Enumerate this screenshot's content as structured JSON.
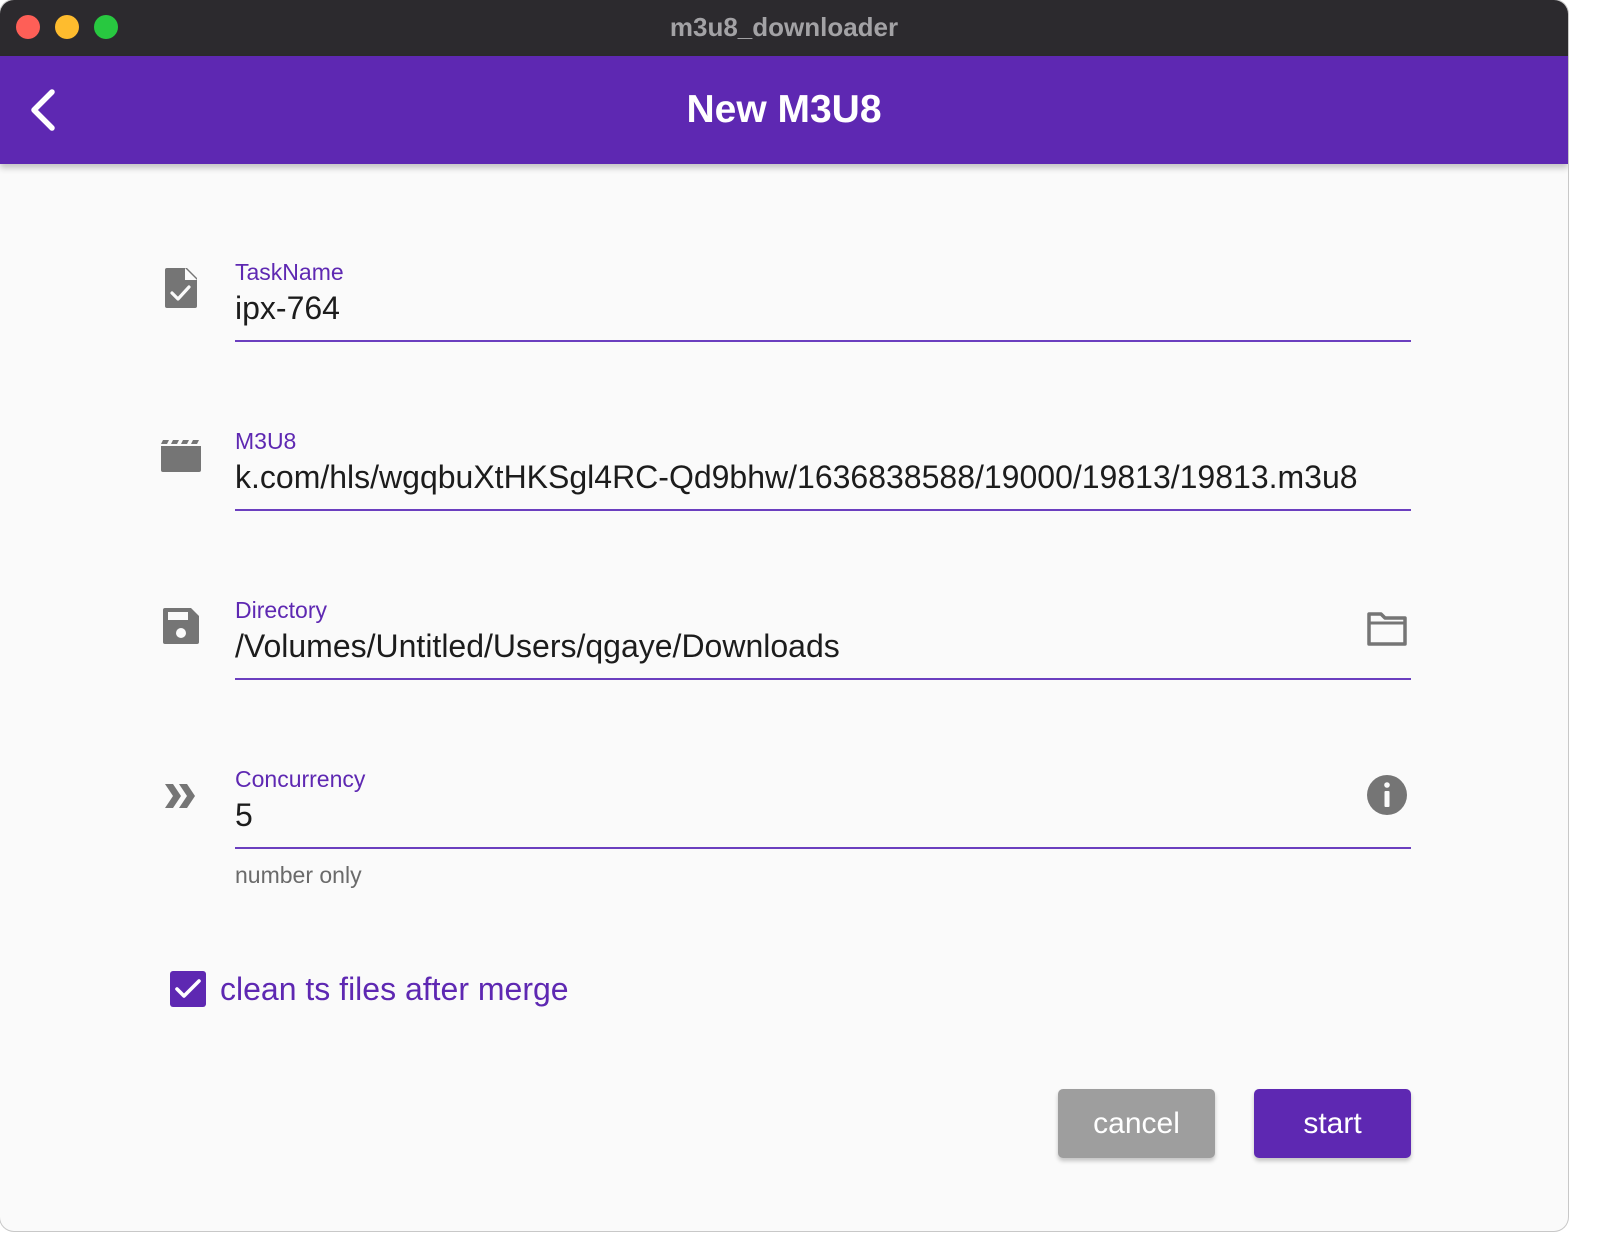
{
  "window": {
    "title": "m3u8_downloader"
  },
  "appbar": {
    "title": "New M3U8"
  },
  "form": {
    "task_name": {
      "label": "TaskName",
      "value": "ipx-764"
    },
    "m3u8": {
      "label": "M3U8",
      "value": "k.com/hls/wgqbuXtHKSgl4RC-Qd9bhw/1636838588/19000/19813/19813.m3u8"
    },
    "directory": {
      "label": "Directory",
      "value": "/Volumes/Untitled/Users/qgaye/Downloads"
    },
    "concurrency": {
      "label": "Concurrency",
      "value": "5",
      "helper": "number only"
    },
    "clean": {
      "label": "clean ts files after merge",
      "checked": true
    }
  },
  "buttons": {
    "cancel": "cancel",
    "start": "start"
  },
  "colors": {
    "accent": "#5e28b2",
    "titlebar": "#2c2a2e",
    "icon": "#757575",
    "cancel": "#9e9e9e"
  },
  "icons": [
    "back-arrow-icon",
    "task-file-check-icon",
    "movie-clapper-icon",
    "save-floppy-icon",
    "folder-icon",
    "double-chevron-right-icon",
    "info-icon",
    "checkmark-icon"
  ]
}
